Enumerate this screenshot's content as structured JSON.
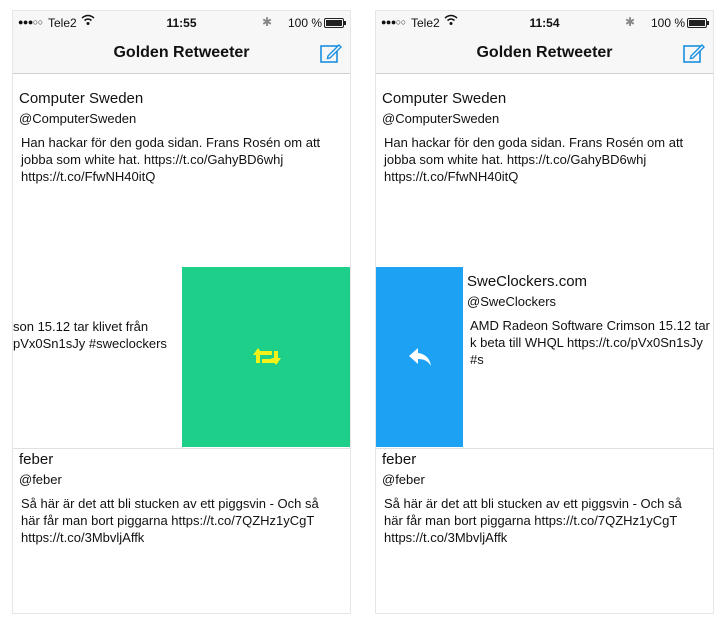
{
  "left": {
    "status": {
      "signal": "●●●○○",
      "carrier": "Tele2",
      "time": "11:55",
      "battery": "100 %"
    },
    "title": "Golden Retweeter",
    "tweet1": {
      "name": "Computer Sweden",
      "handle": "@ComputerSweden",
      "text": "Han hackar för den goda sidan. Frans Rosén om att jobba som white hat. https://t.co/GahyBD6whj https://t.co/FfwNH40itQ"
    },
    "tweet2": {
      "text": "son 15.12 tar klivet från pVx0Sn1sJy #sweclockers"
    },
    "tweet3": {
      "name": "feber",
      "handle": "@feber",
      "text": "Så här är det att bli stucken av ett piggsvin - Och så här får man bort piggarna https://t.co/7QZHz1yCgT https://t.co/3MbvljAffk"
    },
    "action_color": "#1ecf8a",
    "action_icon": "retweet-icon"
  },
  "right": {
    "status": {
      "signal": "●●●○○",
      "carrier": "Tele2",
      "time": "11:54",
      "battery": "100 %"
    },
    "title": "Golden Retweeter",
    "tweet1": {
      "name": "Computer Sweden",
      "handle": "@ComputerSweden",
      "text": "Han hackar för den goda sidan. Frans Rosén om att jobba som white hat. https://t.co/GahyBD6whj https://t.co/FfwNH40itQ"
    },
    "tweet2": {
      "name": "SweClockers.com",
      "handle": "@SweClockers",
      "text": "AMD Radeon Software Crimson 15.12 tar k beta till WHQL https://t.co/pVx0Sn1sJy #s"
    },
    "tweet3": {
      "name": "feber",
      "handle": "@feber",
      "text": "Så här är det att bli stucken av ett piggsvin - Och så här får man bort piggarna https://t.co/7QZHz1yCgT https://t.co/3MbvljAffk"
    },
    "action_color": "#1da1f2",
    "action_icon": "reply-icon"
  }
}
